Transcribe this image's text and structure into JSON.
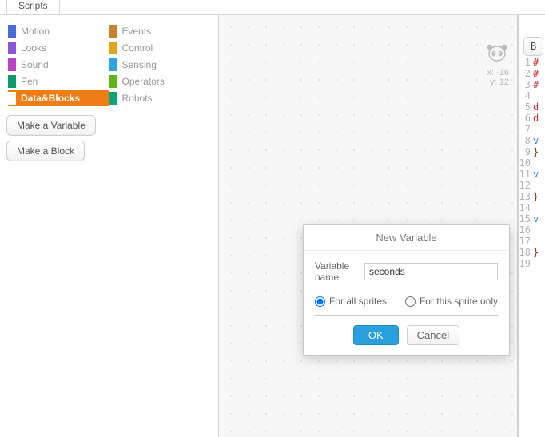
{
  "colors": {
    "accent_orange": "#ee7d16",
    "motion": "#4a6cd4",
    "looks": "#8a55d7",
    "sound": "#bb42c3",
    "pen": "#0e9a6c",
    "data": "#ee7d16",
    "events": "#c88330",
    "control": "#e1a91a",
    "sensing": "#2ca5e2",
    "operators": "#5cb712",
    "robots": "#0da57a"
  },
  "tabs": {
    "scripts": "Scripts"
  },
  "categories_left": [
    {
      "key": "motion",
      "label": "Motion",
      "color": "#4a6cd4"
    },
    {
      "key": "looks",
      "label": "Looks",
      "color": "#8a55d7"
    },
    {
      "key": "sound",
      "label": "Sound",
      "color": "#bb42c3"
    },
    {
      "key": "pen",
      "label": "Pen",
      "color": "#0e9a6c"
    },
    {
      "key": "data",
      "label": "Data&Blocks",
      "color": "#ee7d16",
      "selected": true
    }
  ],
  "categories_right": [
    {
      "key": "events",
      "label": "Events",
      "color": "#c88330"
    },
    {
      "key": "control",
      "label": "Control",
      "color": "#e1a91a"
    },
    {
      "key": "sensing",
      "label": "Sensing",
      "color": "#2ca5e2"
    },
    {
      "key": "operators",
      "label": "Operators",
      "color": "#5cb712"
    },
    {
      "key": "robots",
      "label": "Robots",
      "color": "#0da57a"
    }
  ],
  "left_buttons": {
    "make_variable": "Make a Variable",
    "make_block": "Make a Block"
  },
  "sprite_info": {
    "x_label": "x:",
    "x_value": "-16",
    "y_label": "y:",
    "y_value": "12"
  },
  "code_button": "B",
  "code_lines": [
    {
      "n": "1",
      "txt": "#",
      "cls": "red"
    },
    {
      "n": "2",
      "txt": "#",
      "cls": "red"
    },
    {
      "n": "3",
      "txt": "#",
      "cls": "red"
    },
    {
      "n": "4",
      "txt": "",
      "cls": ""
    },
    {
      "n": "5",
      "txt": "d",
      "cls": "red"
    },
    {
      "n": "6",
      "txt": "d",
      "cls": "red"
    },
    {
      "n": "7",
      "txt": "",
      "cls": ""
    },
    {
      "n": "8",
      "txt": "v",
      "cls": "lblue"
    },
    {
      "n": "9",
      "txt": "}",
      "cls": "brown"
    },
    {
      "n": "10",
      "txt": "",
      "cls": ""
    },
    {
      "n": "11",
      "txt": "v",
      "cls": "lblue"
    },
    {
      "n": "12",
      "txt": "",
      "cls": ""
    },
    {
      "n": "13",
      "txt": "}",
      "cls": "brown"
    },
    {
      "n": "14",
      "txt": "",
      "cls": ""
    },
    {
      "n": "15",
      "txt": "v",
      "cls": "lblue"
    },
    {
      "n": "16",
      "txt": "",
      "cls": ""
    },
    {
      "n": "17",
      "txt": "",
      "cls": ""
    },
    {
      "n": "18",
      "txt": "}",
      "cls": "brown"
    },
    {
      "n": "19",
      "txt": "",
      "cls": ""
    }
  ],
  "dialog": {
    "title": "New Variable",
    "name_label": "Variable name:",
    "name_value": "seconds",
    "scope_all_label": "For all sprites",
    "scope_this_label": "For this sprite only",
    "scope_selected": "all",
    "ok_label": "OK",
    "cancel_label": "Cancel"
  }
}
